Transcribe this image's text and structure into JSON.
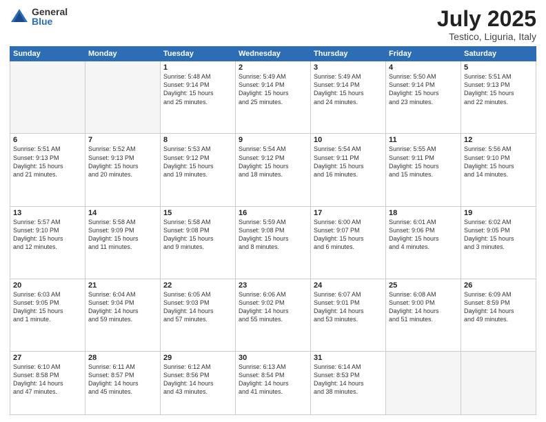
{
  "logo": {
    "general": "General",
    "blue": "Blue"
  },
  "header": {
    "month_year": "July 2025",
    "location": "Testico, Liguria, Italy"
  },
  "days_of_week": [
    "Sunday",
    "Monday",
    "Tuesday",
    "Wednesday",
    "Thursday",
    "Friday",
    "Saturday"
  ],
  "weeks": [
    [
      {
        "day": "",
        "info": "",
        "empty": true
      },
      {
        "day": "",
        "info": "",
        "empty": true
      },
      {
        "day": "1",
        "info": "Sunrise: 5:48 AM\nSunset: 9:14 PM\nDaylight: 15 hours\nand 25 minutes."
      },
      {
        "day": "2",
        "info": "Sunrise: 5:49 AM\nSunset: 9:14 PM\nDaylight: 15 hours\nand 25 minutes."
      },
      {
        "day": "3",
        "info": "Sunrise: 5:49 AM\nSunset: 9:14 PM\nDaylight: 15 hours\nand 24 minutes."
      },
      {
        "day": "4",
        "info": "Sunrise: 5:50 AM\nSunset: 9:14 PM\nDaylight: 15 hours\nand 23 minutes."
      },
      {
        "day": "5",
        "info": "Sunrise: 5:51 AM\nSunset: 9:13 PM\nDaylight: 15 hours\nand 22 minutes."
      }
    ],
    [
      {
        "day": "6",
        "info": "Sunrise: 5:51 AM\nSunset: 9:13 PM\nDaylight: 15 hours\nand 21 minutes."
      },
      {
        "day": "7",
        "info": "Sunrise: 5:52 AM\nSunset: 9:13 PM\nDaylight: 15 hours\nand 20 minutes."
      },
      {
        "day": "8",
        "info": "Sunrise: 5:53 AM\nSunset: 9:12 PM\nDaylight: 15 hours\nand 19 minutes."
      },
      {
        "day": "9",
        "info": "Sunrise: 5:54 AM\nSunset: 9:12 PM\nDaylight: 15 hours\nand 18 minutes."
      },
      {
        "day": "10",
        "info": "Sunrise: 5:54 AM\nSunset: 9:11 PM\nDaylight: 15 hours\nand 16 minutes."
      },
      {
        "day": "11",
        "info": "Sunrise: 5:55 AM\nSunset: 9:11 PM\nDaylight: 15 hours\nand 15 minutes."
      },
      {
        "day": "12",
        "info": "Sunrise: 5:56 AM\nSunset: 9:10 PM\nDaylight: 15 hours\nand 14 minutes."
      }
    ],
    [
      {
        "day": "13",
        "info": "Sunrise: 5:57 AM\nSunset: 9:10 PM\nDaylight: 15 hours\nand 12 minutes."
      },
      {
        "day": "14",
        "info": "Sunrise: 5:58 AM\nSunset: 9:09 PM\nDaylight: 15 hours\nand 11 minutes."
      },
      {
        "day": "15",
        "info": "Sunrise: 5:58 AM\nSunset: 9:08 PM\nDaylight: 15 hours\nand 9 minutes."
      },
      {
        "day": "16",
        "info": "Sunrise: 5:59 AM\nSunset: 9:08 PM\nDaylight: 15 hours\nand 8 minutes."
      },
      {
        "day": "17",
        "info": "Sunrise: 6:00 AM\nSunset: 9:07 PM\nDaylight: 15 hours\nand 6 minutes."
      },
      {
        "day": "18",
        "info": "Sunrise: 6:01 AM\nSunset: 9:06 PM\nDaylight: 15 hours\nand 4 minutes."
      },
      {
        "day": "19",
        "info": "Sunrise: 6:02 AM\nSunset: 9:05 PM\nDaylight: 15 hours\nand 3 minutes."
      }
    ],
    [
      {
        "day": "20",
        "info": "Sunrise: 6:03 AM\nSunset: 9:05 PM\nDaylight: 15 hours\nand 1 minute."
      },
      {
        "day": "21",
        "info": "Sunrise: 6:04 AM\nSunset: 9:04 PM\nDaylight: 14 hours\nand 59 minutes."
      },
      {
        "day": "22",
        "info": "Sunrise: 6:05 AM\nSunset: 9:03 PM\nDaylight: 14 hours\nand 57 minutes."
      },
      {
        "day": "23",
        "info": "Sunrise: 6:06 AM\nSunset: 9:02 PM\nDaylight: 14 hours\nand 55 minutes."
      },
      {
        "day": "24",
        "info": "Sunrise: 6:07 AM\nSunset: 9:01 PM\nDaylight: 14 hours\nand 53 minutes."
      },
      {
        "day": "25",
        "info": "Sunrise: 6:08 AM\nSunset: 9:00 PM\nDaylight: 14 hours\nand 51 minutes."
      },
      {
        "day": "26",
        "info": "Sunrise: 6:09 AM\nSunset: 8:59 PM\nDaylight: 14 hours\nand 49 minutes."
      }
    ],
    [
      {
        "day": "27",
        "info": "Sunrise: 6:10 AM\nSunset: 8:58 PM\nDaylight: 14 hours\nand 47 minutes."
      },
      {
        "day": "28",
        "info": "Sunrise: 6:11 AM\nSunset: 8:57 PM\nDaylight: 14 hours\nand 45 minutes."
      },
      {
        "day": "29",
        "info": "Sunrise: 6:12 AM\nSunset: 8:56 PM\nDaylight: 14 hours\nand 43 minutes."
      },
      {
        "day": "30",
        "info": "Sunrise: 6:13 AM\nSunset: 8:54 PM\nDaylight: 14 hours\nand 41 minutes."
      },
      {
        "day": "31",
        "info": "Sunrise: 6:14 AM\nSunset: 8:53 PM\nDaylight: 14 hours\nand 38 minutes."
      },
      {
        "day": "",
        "info": "",
        "empty": true
      },
      {
        "day": "",
        "info": "",
        "empty": true
      }
    ]
  ]
}
